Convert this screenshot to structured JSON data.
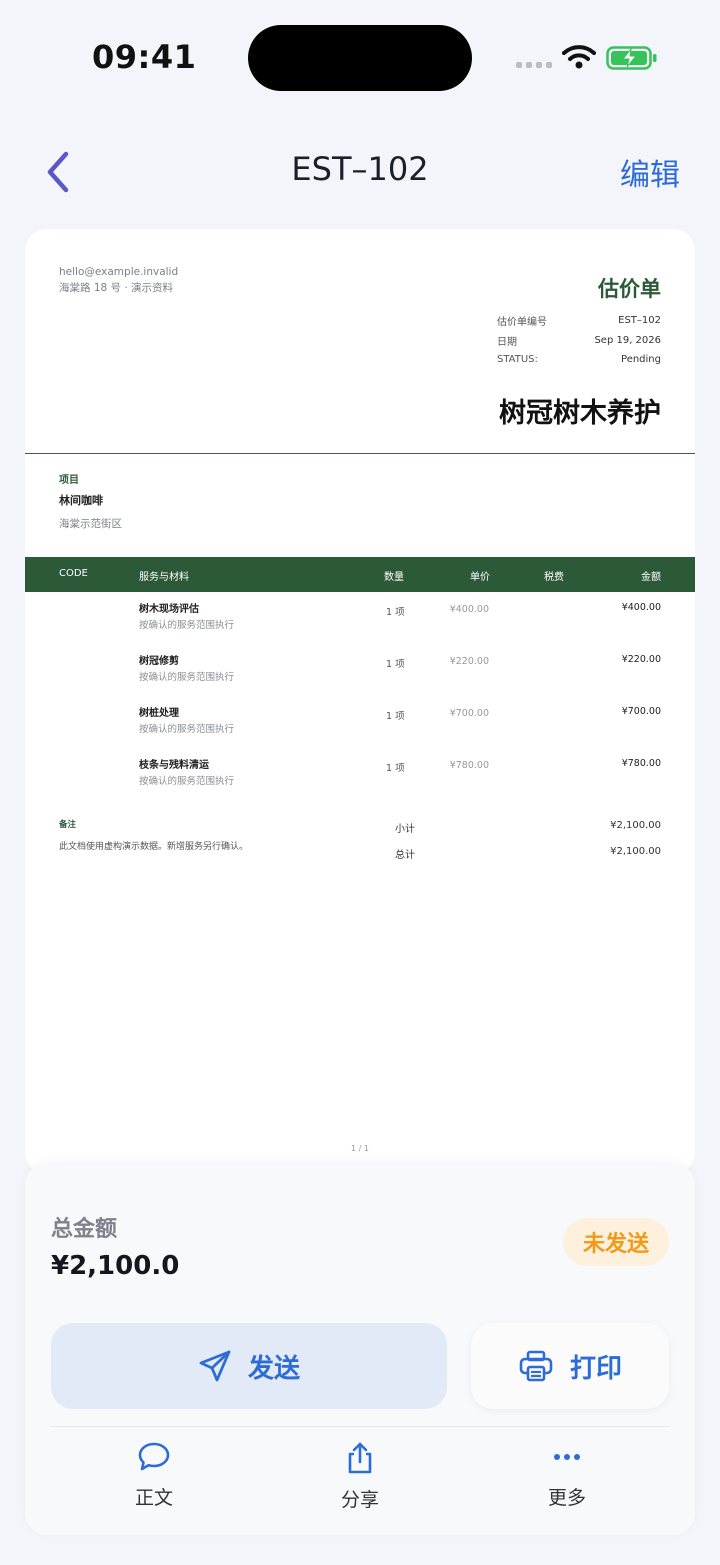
{
  "status_bar": {
    "time": "09:41"
  },
  "nav": {
    "title": "EST–102",
    "edit_label": "编辑"
  },
  "document": {
    "contact_email": "hello@example.invalid",
    "contact_address": "海棠路 18 号 · 演示资料",
    "doc_type": "估价单",
    "meta": [
      {
        "label": "估价单编号",
        "value": "EST–102"
      },
      {
        "label": "日期",
        "value": "Sep 19, 2026"
      },
      {
        "label": "STATUS:",
        "value": "Pending"
      }
    ],
    "company_name": "树冠树木养护",
    "project": {
      "label": "项目",
      "client": "林间咖啡",
      "address": "海棠示范街区"
    },
    "table_headers": {
      "code": "CODE",
      "item": "服务与材料",
      "qty": "数量",
      "price": "单价",
      "tax": "税费",
      "amount": "金额"
    },
    "items": [
      {
        "name": "树木现场评估",
        "desc": "按确认的服务范围执行",
        "qty": "1 项",
        "price": "¥400.00",
        "amount": "¥400.00"
      },
      {
        "name": "树冠修剪",
        "desc": "按确认的服务范围执行",
        "qty": "1 项",
        "price": "¥220.00",
        "amount": "¥220.00"
      },
      {
        "name": "树桩处理",
        "desc": "按确认的服务范围执行",
        "qty": "1 项",
        "price": "¥700.00",
        "amount": "¥700.00"
      },
      {
        "name": "枝条与残料清运",
        "desc": "按确认的服务范围执行",
        "qty": "1 项",
        "price": "¥780.00",
        "amount": "¥780.00"
      }
    ],
    "notes_label": "备注",
    "notes_text": "此文档使用虚构演示数据。新增服务另行确认。",
    "subtotal_label": "小计",
    "subtotal_value": "¥2,100.00",
    "total_label": "总计",
    "total_value": "¥2,100.00",
    "page_number": "1 / 1"
  },
  "summary": {
    "total_label": "总金额",
    "total_value": "¥2,100.0",
    "status_badge": "未发送",
    "send_label": "发送",
    "print_label": "打印"
  },
  "tabs": [
    {
      "label": "正文",
      "icon": "chat-bubble-icon"
    },
    {
      "label": "分享",
      "icon": "share-icon"
    },
    {
      "label": "更多",
      "icon": "more-icon"
    }
  ],
  "colors": {
    "accent": "#2d6cd6",
    "brand_green": "#2c5a38",
    "badge_text": "#f09a17",
    "badge_bg": "#fdf0dc"
  }
}
